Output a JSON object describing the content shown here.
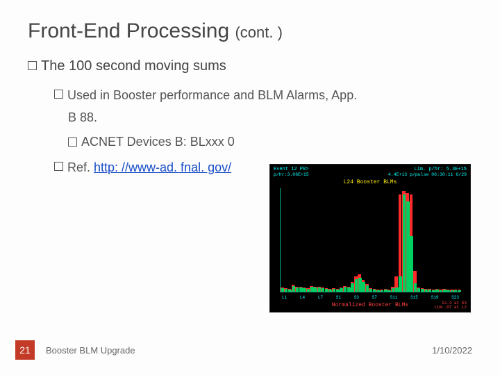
{
  "title_main": "Front-End Processing ",
  "title_cont": "(cont. )",
  "b1": "The 100 second moving sums",
  "b2": "Used in Booster performance and BLM Alarms, App.",
  "b2_cont": "B 88.",
  "b3": " ACNET Devices B: BLxxx 0",
  "b4_prefix": "Ref.  ",
  "b4_link": "http: //www-ad. fnal. gov/",
  "footer": {
    "page": "21",
    "title": "Booster BLM Upgrade",
    "date": "1/10/2022"
  },
  "chart_data": {
    "type": "bar",
    "title": "L24 Booster BLMs",
    "header_left": "Event 12  PR>",
    "header_right": "Lim. p/hr:   5.3E+15",
    "sub_left": "p/hr:3.06E+15",
    "sub_right": "4.4E+13 p/pulse   06:30:11 6/29",
    "xlabel": "Normalized Booster BLMs",
    "series": [
      {
        "name": "green",
        "color": "#00d060",
        "values": [
          5,
          4,
          3,
          8,
          6,
          6,
          5,
          4,
          7,
          6,
          6,
          5,
          4,
          3,
          4,
          3,
          5,
          7,
          6,
          12,
          18,
          20,
          14,
          9,
          4,
          3,
          2,
          2,
          3,
          2,
          5,
          6,
          22,
          140,
          130,
          80,
          12,
          5,
          4,
          3,
          3,
          2,
          3,
          2,
          3,
          2,
          2,
          2,
          2
        ]
      },
      {
        "name": "red",
        "color": "#ff2a2a",
        "values": [
          6,
          5,
          4,
          10,
          7,
          7,
          6,
          5,
          8,
          7,
          7,
          6,
          5,
          4,
          5,
          4,
          6,
          8,
          7,
          14,
          22,
          25,
          17,
          11,
          5,
          4,
          3,
          3,
          4,
          3,
          7,
          22,
          140,
          145,
          142,
          140,
          30,
          6,
          5,
          4,
          4,
          3,
          4,
          3,
          4,
          3,
          3,
          3,
          3
        ]
      }
    ],
    "xticks": [
      "L1",
      "L4",
      "L7",
      "S1",
      "S3",
      "S7",
      "S11",
      "S15",
      "S19",
      "S23"
    ],
    "footer_lines": [
      "12.4 at S3",
      "Lim:.07 at L2"
    ]
  }
}
